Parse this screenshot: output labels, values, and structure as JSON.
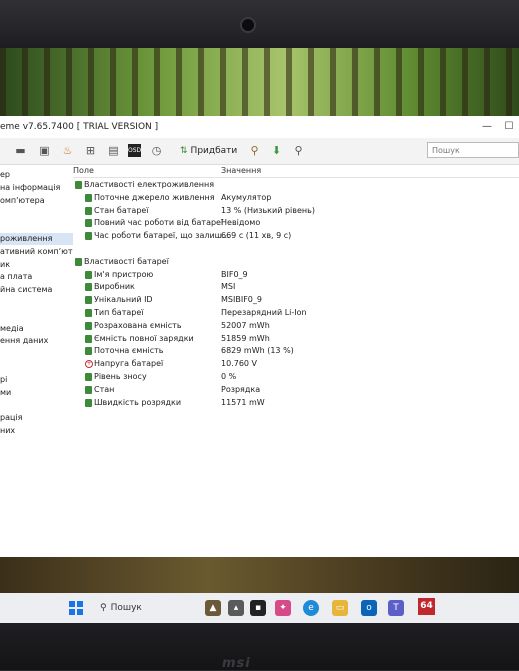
{
  "window": {
    "title": "eme v7.65.7400  [ TRIAL VERSION ]"
  },
  "toolbar": {
    "report_label": "Придбати",
    "search_placeholder": "Пошук"
  },
  "sidebar": {
    "items": [
      {
        "label": "ер",
        "selected": false
      },
      {
        "label": "на інформація",
        "selected": false
      },
      {
        "label": "омп'ютера",
        "selected": false
      },
      {
        "label": "",
        "selected": false
      },
      {
        "label": "",
        "selected": false
      },
      {
        "label": "роживлення",
        "selected": true
      },
      {
        "label": "ативний компʼюте",
        "selected": false
      },
      {
        "label": "ик",
        "selected": false
      },
      {
        "label": "а плата",
        "selected": false
      },
      {
        "label": "йна система",
        "selected": false
      },
      {
        "label": "",
        "selected": false
      },
      {
        "label": "",
        "selected": false
      },
      {
        "label": "медіа",
        "selected": false
      },
      {
        "label": "ення даних",
        "selected": false
      },
      {
        "label": "",
        "selected": false
      },
      {
        "label": "",
        "selected": false
      },
      {
        "label": "рі",
        "selected": false
      },
      {
        "label": "ми",
        "selected": false
      },
      {
        "label": "",
        "selected": false
      },
      {
        "label": "рація",
        "selected": false
      },
      {
        "label": "них",
        "selected": false
      }
    ]
  },
  "content": {
    "columns": {
      "field": "Поле",
      "value": "Значення"
    },
    "rows": [
      {
        "indent": 0,
        "label": "Властивості електроживлення",
        "value": "",
        "icon": "group"
      },
      {
        "indent": 1,
        "label": "Поточне джерело живлення",
        "value": "Акумулятор",
        "icon": "battery"
      },
      {
        "indent": 1,
        "label": "Стан батареї",
        "value": "13 % (Низький рівень)",
        "icon": "battery"
      },
      {
        "indent": 1,
        "label": "Повний час роботи від батареї",
        "value": "Невідомо",
        "icon": "battery"
      },
      {
        "indent": 1,
        "label": "Час роботи батареї, що залиш...",
        "value": "669 с (11 хв, 9 с)",
        "icon": "battery"
      },
      {
        "indent": -1,
        "label": "",
        "value": "",
        "icon": "none"
      },
      {
        "indent": 0,
        "label": "Властивості батареї",
        "value": "",
        "icon": "group"
      },
      {
        "indent": 1,
        "label": "Ім'я пристрою",
        "value": "BIF0_9",
        "icon": "battery"
      },
      {
        "indent": 1,
        "label": "Виробник",
        "value": "MSI",
        "icon": "battery"
      },
      {
        "indent": 1,
        "label": "Унікальний ID",
        "value": "MSIBIF0_9",
        "icon": "battery"
      },
      {
        "indent": 1,
        "label": "Тип батареї",
        "value": "Перезарядний Li-Ion",
        "icon": "battery"
      },
      {
        "indent": 1,
        "label": "Розрахована ємність",
        "value": "52007 mWh",
        "icon": "battery"
      },
      {
        "indent": 1,
        "label": "Ємність повної зарядки",
        "value": "51859 mWh",
        "icon": "battery"
      },
      {
        "indent": 1,
        "label": "Поточна ємність",
        "value": "6829 mWh  (13 %)",
        "icon": "battery"
      },
      {
        "indent": 1,
        "label": "Напруга батареї",
        "value": "10.760 V",
        "icon": "warning"
      },
      {
        "indent": 1,
        "label": "Рівень зносу",
        "value": "0 %",
        "icon": "battery"
      },
      {
        "indent": 1,
        "label": "Стан",
        "value": "Розрядка",
        "icon": "battery"
      },
      {
        "indent": 1,
        "label": "Швидкість розрядки",
        "value": "11571 mW",
        "icon": "battery"
      }
    ]
  },
  "taskbar": {
    "search_label": "Пошук",
    "aida_label": "64"
  },
  "bezel": {
    "logo": "msi"
  },
  "colors": {
    "battery_icon": "#3f8a3a",
    "selected_row": "#d7e4f3",
    "aida_red": "#c0282d",
    "start_blue": "#1a73e8"
  }
}
